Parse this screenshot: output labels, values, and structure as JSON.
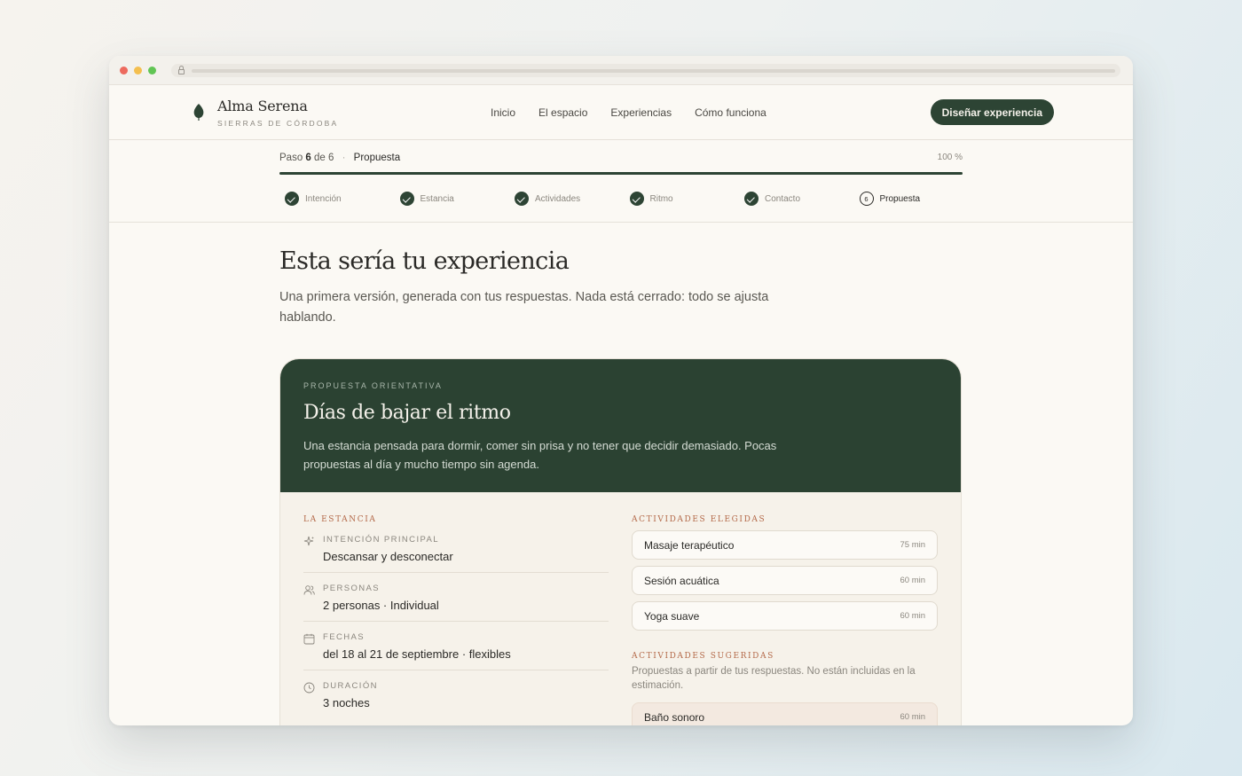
{
  "brand": {
    "name": "Alma Serena",
    "subtitle": "SIERRAS DE CÓRDOBA"
  },
  "nav": {
    "items": [
      "Inicio",
      "El espacio",
      "Experiencias",
      "Cómo funciona"
    ],
    "cta": "Diseñar experiencia"
  },
  "progress": {
    "step_word": "Paso",
    "step_current": "6",
    "step_of": "de 6",
    "step_name": "Propuesta",
    "percent_label": "100 %",
    "percent": 1.0,
    "steps": [
      {
        "label": "Intención",
        "state": "done"
      },
      {
        "label": "Estancia",
        "state": "done"
      },
      {
        "label": "Actividades",
        "state": "done"
      },
      {
        "label": "Ritmo",
        "state": "done"
      },
      {
        "label": "Contacto",
        "state": "done"
      },
      {
        "label": "Propuesta",
        "state": "current",
        "number": "6"
      }
    ]
  },
  "main": {
    "title": "Esta sería tu experiencia",
    "intro": "Una primera versión, generada con tus respuestas. Nada está cerrado: todo se ajusta hablando."
  },
  "proposal": {
    "eyebrow": "PROPUESTA ORIENTATIVA",
    "title": "Días de bajar el ritmo",
    "description": "Una estancia pensada para dormir, comer sin prisa y no tener que decidir demasiado. Pocas propuestas al día y mucho tiempo sin agenda.",
    "stay_title": "LA ESTANCIA",
    "stay": [
      {
        "icon": "sparkle-icon",
        "label": "INTENCIÓN PRINCIPAL",
        "value": "Descansar y desconectar"
      },
      {
        "icon": "people-icon",
        "label": "PERSONAS",
        "value": "2 personas · Individual"
      },
      {
        "icon": "calendar-icon",
        "label": "FECHAS",
        "value": "del 18 al 21 de septiembre · flexibles"
      },
      {
        "icon": "clock-icon",
        "label": "DURACIÓN",
        "value": "3 noches"
      }
    ],
    "chosen_title": "ACTIVIDADES ELEGIDAS",
    "chosen": [
      {
        "name": "Masaje terapéutico",
        "duration": "75 min"
      },
      {
        "name": "Sesión acuática",
        "duration": "60 min"
      },
      {
        "name": "Yoga suave",
        "duration": "60 min"
      }
    ],
    "suggested_title": "ACTIVIDADES SUGERIDAS",
    "suggested_desc": "Propuestas a partir de tus respuestas. No están incluidas en la estimación.",
    "suggested": [
      {
        "name": "Baño sonoro",
        "duration": "60 min"
      }
    ]
  },
  "colors": {
    "accent": "#2d4434",
    "eyebrow_accent": "#b46a4a",
    "background": "#fbf9f4"
  }
}
